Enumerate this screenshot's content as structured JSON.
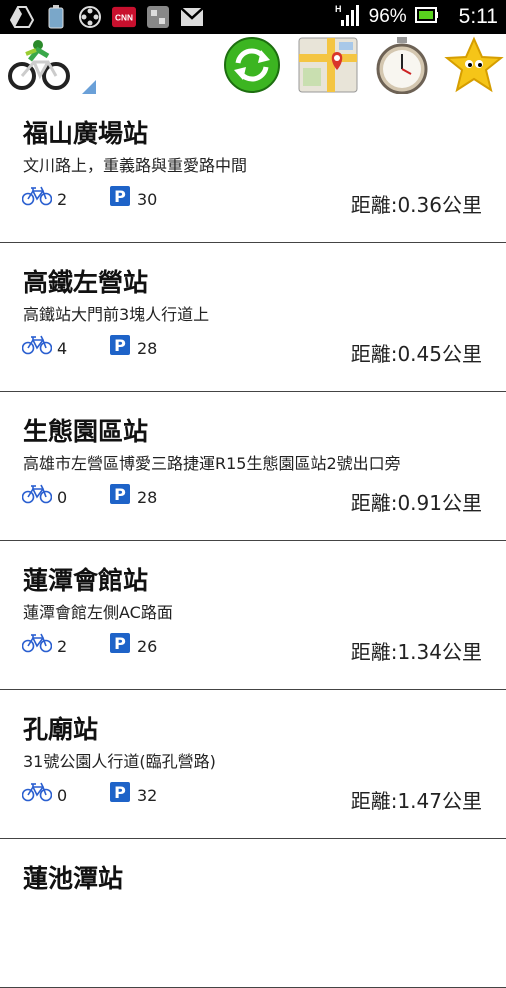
{
  "status_bar": {
    "battery_text": "96%",
    "time": "5:11",
    "signal_label": "H",
    "notification_icons": [
      "drive-icon",
      "battery-app-icon",
      "film-reel-icon",
      "cnn-icon",
      "music-app-icon",
      "gmail-icon"
    ],
    "cnn_text": "CNN"
  },
  "action_bar": {
    "logo_icon": "bicycle-logo-icon",
    "buttons": [
      {
        "name": "refresh-button",
        "icon": "refresh-icon"
      },
      {
        "name": "map-button",
        "icon": "map-icon"
      },
      {
        "name": "stopwatch-button",
        "icon": "stopwatch-icon"
      },
      {
        "name": "favorite-button",
        "icon": "star-icon"
      }
    ]
  },
  "colors": {
    "bike_blue": "#2a5fd0",
    "parking_blue": "#1e63c8",
    "refresh_green": "#3cb521",
    "star_yellow": "#f5c518"
  },
  "stations": [
    {
      "name": "福山廣場站",
      "address": "文川路上，重義路與重愛路中間",
      "bikes": "2",
      "parking": "30",
      "distance": "距離:0.36公里"
    },
    {
      "name": "高鐵左營站",
      "address": "高鐵站大門前3塊人行道上",
      "bikes": "4",
      "parking": "28",
      "distance": "距離:0.45公里"
    },
    {
      "name": "生態園區站",
      "address": "高雄市左營區博愛三路捷運R15生態園區站2號出口旁",
      "bikes": "0",
      "parking": "28",
      "distance": "距離:0.91公里"
    },
    {
      "name": "蓮潭會館站",
      "address": "蓮潭會館左側AC路面",
      "bikes": "2",
      "parking": "26",
      "distance": "距離:1.34公里"
    },
    {
      "name": "孔廟站",
      "address": "31號公園人行道(臨孔營路)",
      "bikes": "0",
      "parking": "32",
      "distance": "距離:1.47公里"
    },
    {
      "name": "蓮池潭站",
      "address": "",
      "bikes": "",
      "parking": "",
      "distance": ""
    }
  ],
  "parking_letter": "P"
}
